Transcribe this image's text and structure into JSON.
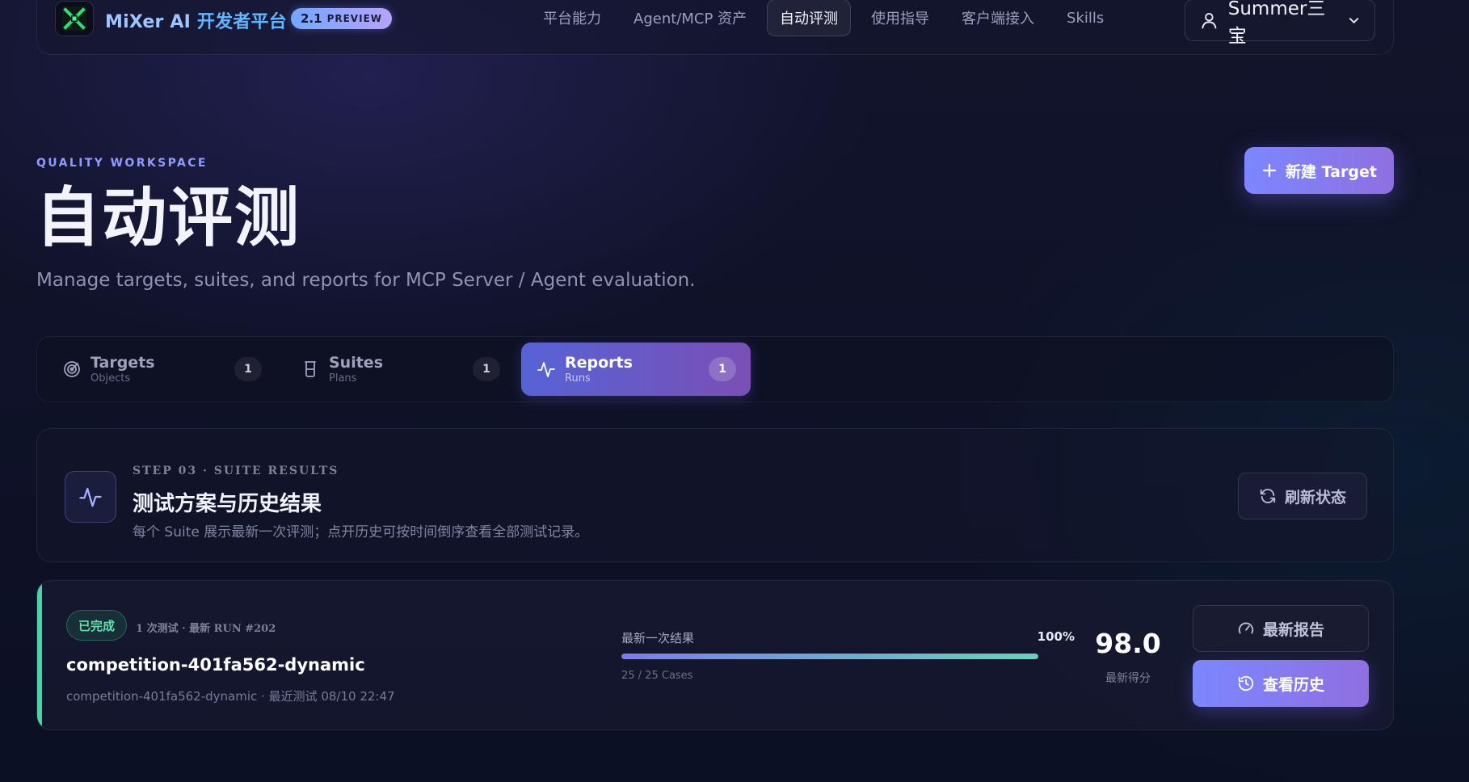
{
  "header": {
    "brand_en": "MiXer AI",
    "brand_zh": "开发者平台",
    "version": "2.1",
    "version_tag": "PREVIEW",
    "nav": [
      {
        "label": "平台能力",
        "active": false
      },
      {
        "label": "Agent/MCP 资产",
        "active": false
      },
      {
        "label": "自动评测",
        "active": true
      },
      {
        "label": "使用指导",
        "active": false
      },
      {
        "label": "客户端接入",
        "active": false
      },
      {
        "label": "Skills",
        "active": false
      }
    ],
    "user_name": "Summer三宝",
    "icons": {
      "logo": "mixer-logo-icon",
      "user": "user-icon",
      "chevron": "chevron-down-icon"
    }
  },
  "page": {
    "eyebrow": "QUALITY WORKSPACE",
    "title": "自动评测",
    "subtitle": "Manage targets, suites, and reports for MCP Server / Agent evaluation.",
    "new_target_label": "新建 Target"
  },
  "tabs": [
    {
      "label": "Targets",
      "sub": "Objects",
      "count": "1",
      "icon": "target-icon",
      "active": false
    },
    {
      "label": "Suites",
      "sub": "Plans",
      "count": "1",
      "icon": "beaker-icon",
      "active": false
    },
    {
      "label": "Reports",
      "sub": "Runs",
      "count": "1",
      "icon": "activity-icon",
      "active": true
    }
  ],
  "section": {
    "step": "STEP 03 · SUITE RESULTS",
    "title": "测试方案与历史结果",
    "description": "每个 Suite 展示最新一次评测；点开历史可按时间倒序查看全部测试记录。",
    "refresh_label": "刷新状态"
  },
  "suite": {
    "status": "已完成",
    "run_meta": "1 次测试 · 最新 RUN #202",
    "name": "competition-401fa562-dynamic",
    "detail": "competition-401fa562-dynamic · 最近测试 08/10 22:47",
    "progress_label": "最新一次结果",
    "progress_pct": "100%",
    "progress_value": 1.0,
    "cases": "25 / 25 Cases",
    "score": "98.0",
    "score_label": "最新得分",
    "latest_report_label": "最新报告",
    "history_label": "查看历史"
  },
  "colors": {
    "accent": "#7c87ff",
    "success": "#4fd1a5",
    "background": "#12142b"
  }
}
